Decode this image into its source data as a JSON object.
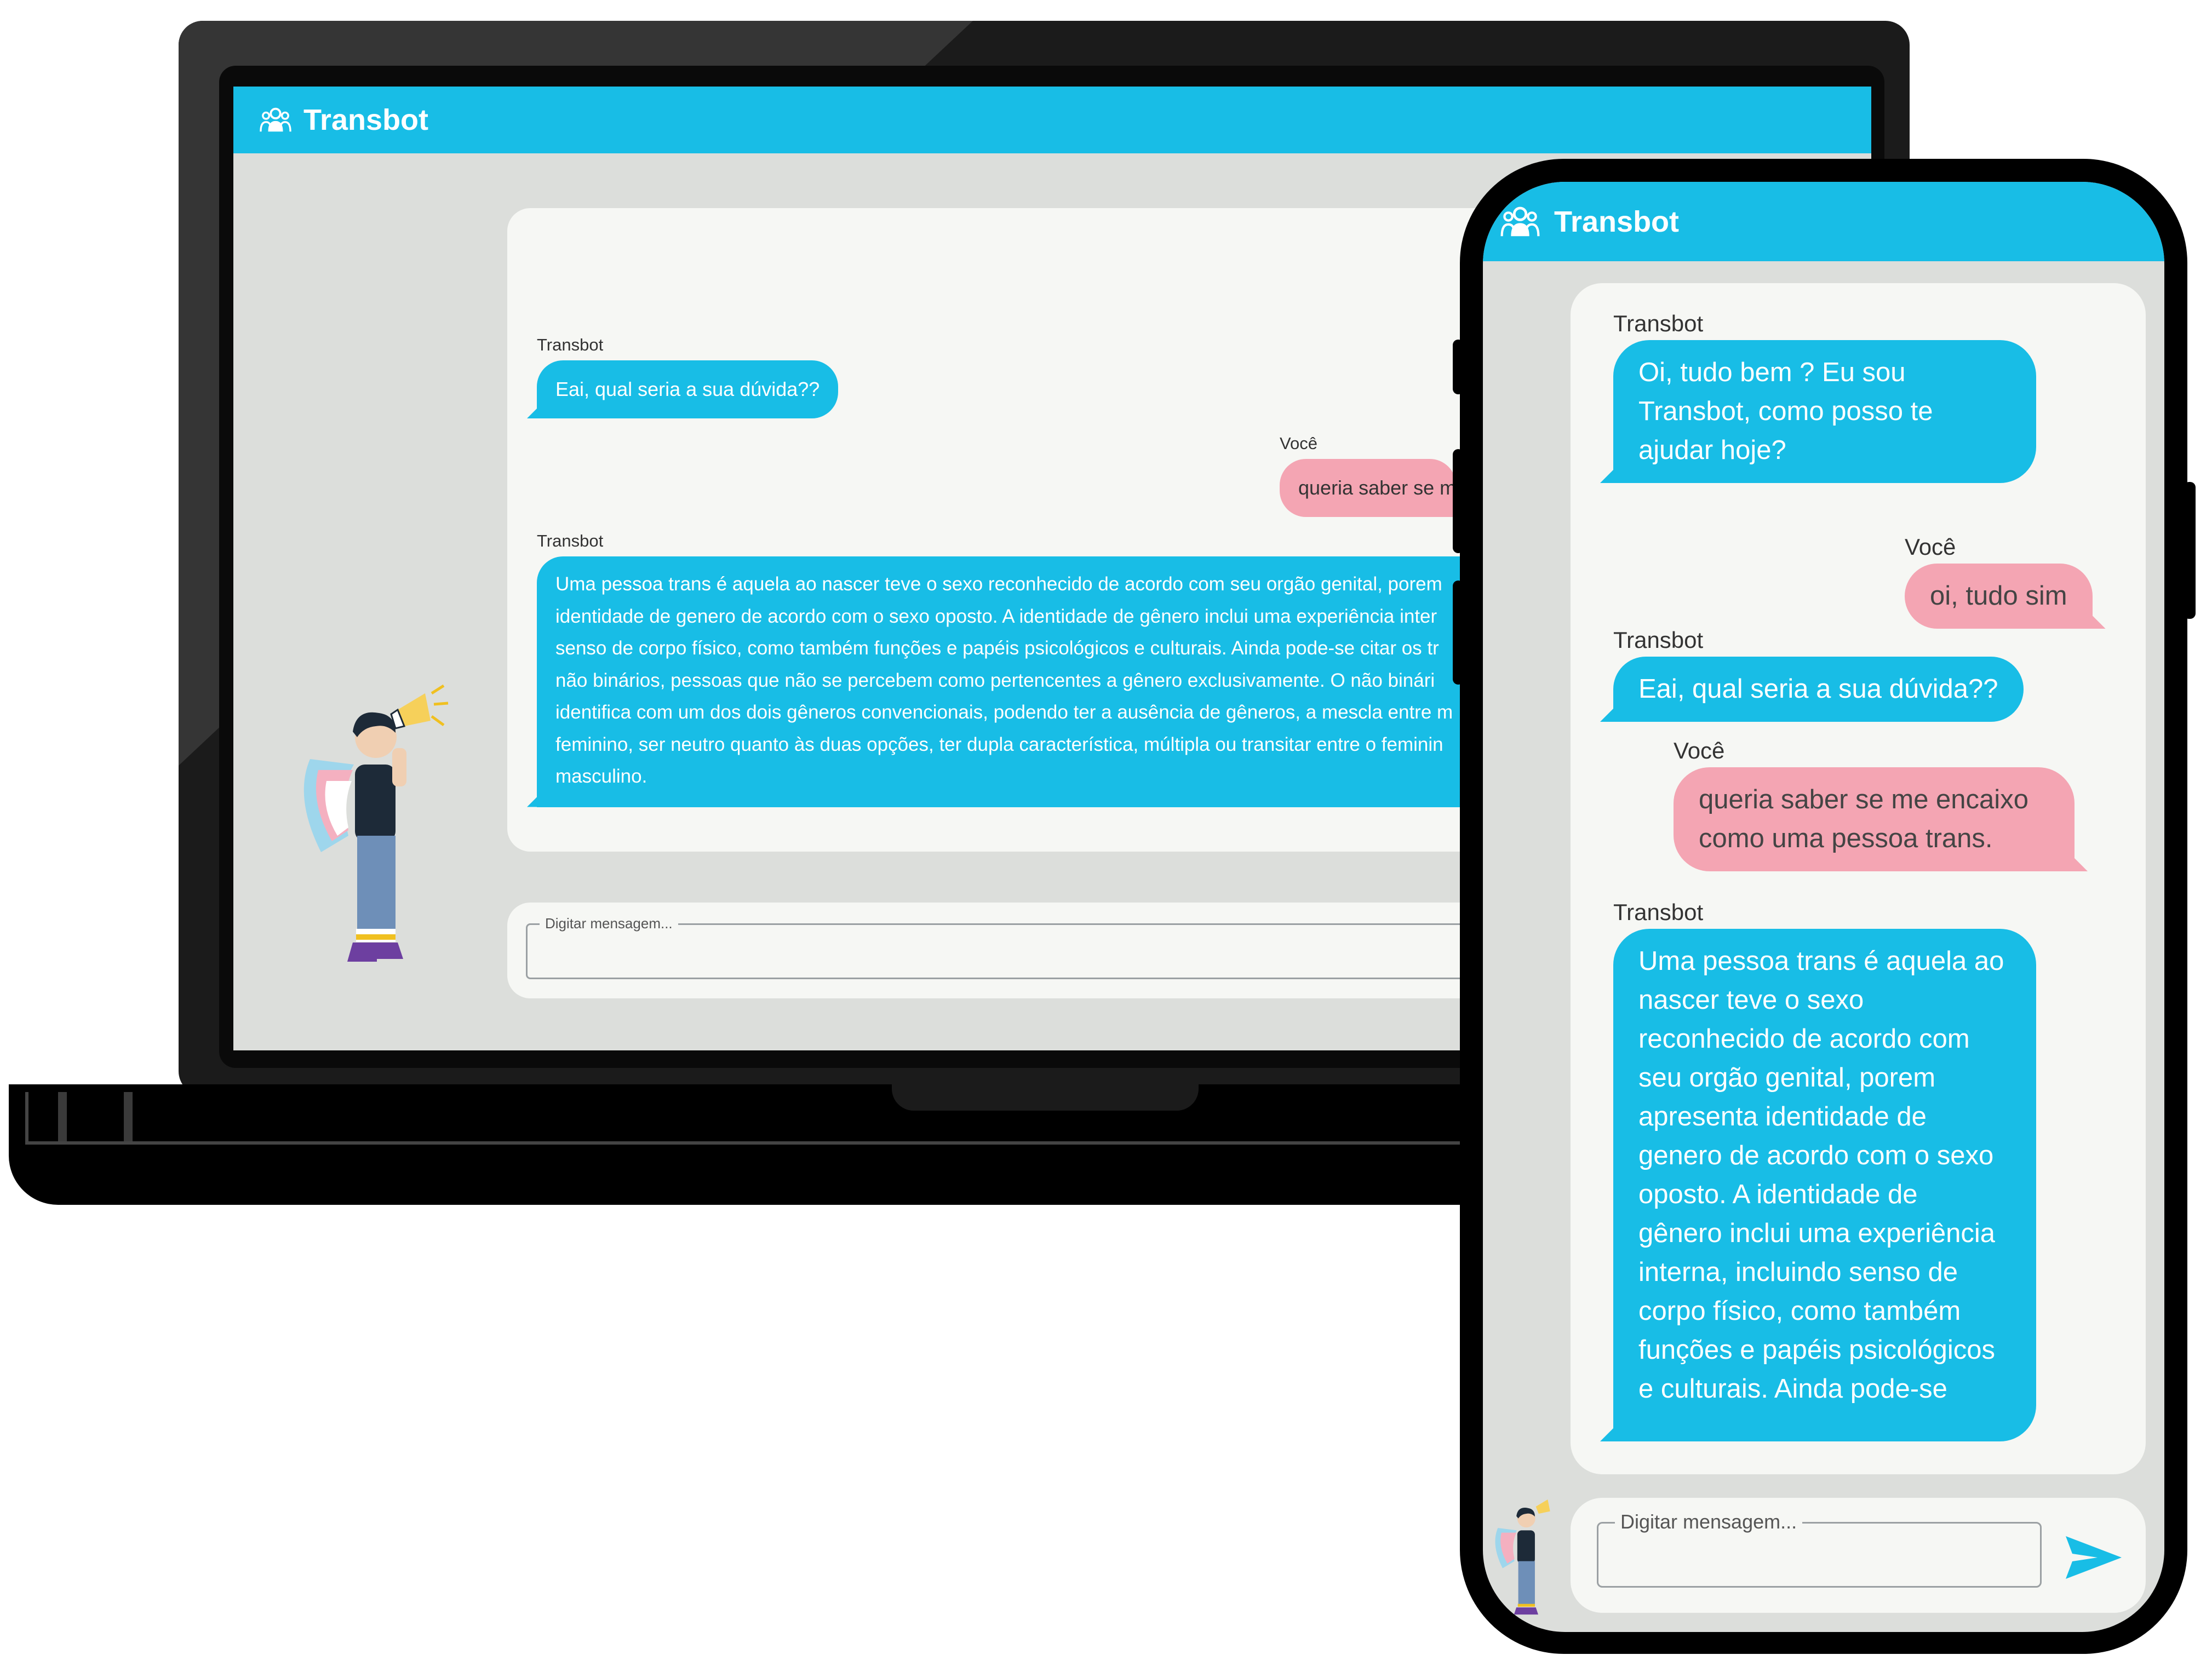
{
  "app": {
    "title": "Transbot",
    "accent_color": "#18bde6",
    "user_bubble_color": "#f4a5b3",
    "background_color": "#dcdedb"
  },
  "desktop": {
    "messages": [
      {
        "sender": "Transbot",
        "text": "Eai, qual seria a sua dúvida??"
      },
      {
        "sender": "Você",
        "text": "queria saber se m"
      },
      {
        "sender": "Transbot",
        "lines": [
          "Uma pessoa trans é aquela ao nascer teve o sexo reconhecido de acordo com seu orgão genital, porem",
          "identidade de genero de acordo com o sexo oposto. A identidade de gênero inclui uma experiência inter",
          "senso de corpo físico, como também funções e papéis psicológicos e culturais. Ainda pode-se citar os tr",
          "não binários, pessoas que não se percebem como pertencentes a gênero exclusivamente. O não binári",
          "identifica com um dos dois gêneros convencionais, podendo ter a ausência de gêneros, a mescla entre m",
          "feminino, ser neutro quanto às duas opções, ter dupla característica, múltipla ou transitar entre o feminin",
          "masculino."
        ]
      }
    ],
    "input_placeholder": "Digitar mensagem..."
  },
  "mobile": {
    "messages": [
      {
        "sender": "Transbot",
        "lines": [
          "Oi, tudo bem ? Eu sou",
          "Transbot, como posso te",
          "ajudar hoje?"
        ]
      },
      {
        "sender": "Você",
        "text": "oi, tudo sim"
      },
      {
        "sender": "Transbot",
        "text": "Eai, qual seria a sua dúvida??"
      },
      {
        "sender": "Você",
        "lines": [
          "queria saber se me encaixo",
          "como uma pessoa trans."
        ]
      },
      {
        "sender": "Transbot",
        "lines": [
          "Uma pessoa trans é aquela ao",
          "nascer teve o sexo",
          "reconhecido de acordo com",
          "seu orgão genital, porem",
          "apresenta identidade de",
          "genero de acordo com o sexo",
          "oposto. A identidade de",
          "gênero inclui uma experiência",
          "interna, incluindo senso de",
          "corpo físico, como também",
          "funções e papéis psicológicos",
          "e culturais. Ainda pode-se"
        ]
      }
    ],
    "input_placeholder": "Digitar mensagem...",
    "icons": {
      "send": "send-icon",
      "logo": "people-icon"
    }
  }
}
